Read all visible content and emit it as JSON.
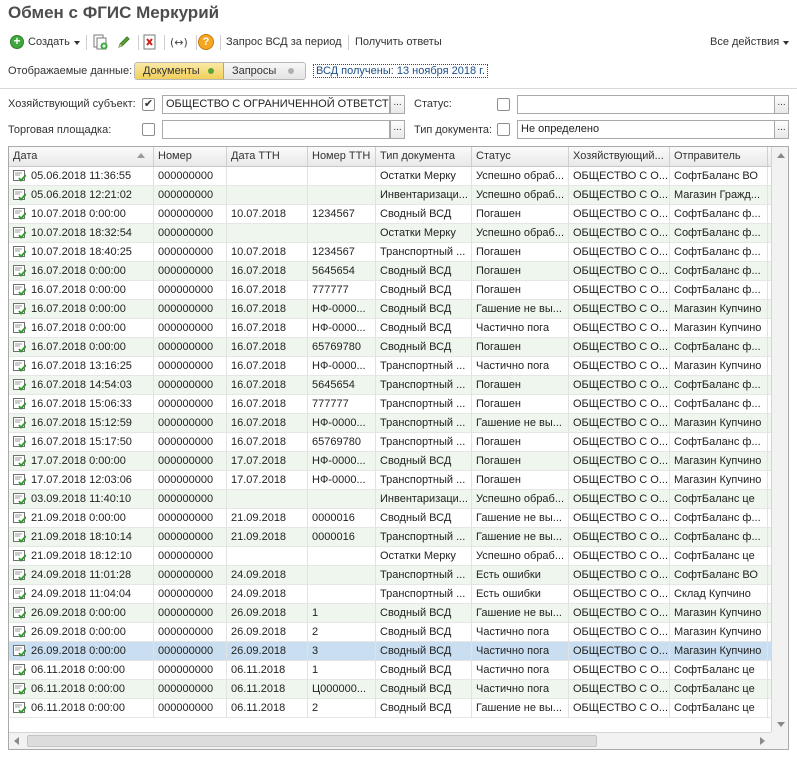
{
  "window": {
    "title": "Обмен с ФГИС Меркурий"
  },
  "toolbar": {
    "create_label": "Создать",
    "request_label": "Запрос ВСД за период",
    "get_answers_label": "Получить ответы",
    "all_actions_label": "Все действия"
  },
  "filters": {
    "displayed_label": "Отображаемые данные:",
    "tab_documents": "Документы",
    "tab_requests": "Запросы",
    "vsd_link": "ВСД получены: 13 ноября 2018 г.",
    "subject_label": "Хозяйствующий субъект:",
    "subject_checked": "✔",
    "subject_value": "ОБЩЕСТВО С ОГРАНИЧЕННОЙ ОТВЕТСТВЕННОСТЬЮ",
    "status_label": "Статус:",
    "status_value": "",
    "place_label": "Торговая площадка:",
    "place_value": "",
    "doc_type_label": "Тип документа:",
    "doc_type_value": "Не определено",
    "select_btn": "..."
  },
  "table": {
    "columns": [
      "Дата",
      "Номер",
      "Дата ТТН",
      "Номер ТТН",
      "Тип документа",
      "Статус",
      "Хозяйствующий...",
      "Отправитель",
      "П"
    ],
    "rows": [
      [
        "05.06.2018 11:36:55",
        "000000000",
        "",
        "",
        "Остатки Мерку",
        "Успешно обраб...",
        "ОБЩЕСТВО С О...",
        "СофтБаланс ВО",
        ""
      ],
      [
        "05.06.2018 12:21:02",
        "000000000",
        "",
        "",
        "Инвентаризаци...",
        "Успешно обраб...",
        "ОБЩЕСТВО С О...",
        "Магазин Гражд...",
        ""
      ],
      [
        "10.07.2018 0:00:00",
        "000000000",
        "10.07.2018",
        "1234567",
        "Сводный ВСД",
        "Погашен",
        "ОБЩЕСТВО С О...",
        "СофтБаланс ф...",
        "М"
      ],
      [
        "10.07.2018 18:32:54",
        "000000000",
        "",
        "",
        "Остатки Мерку",
        "Успешно обраб...",
        "ОБЩЕСТВО С О...",
        "СофтБаланс ф...",
        ""
      ],
      [
        "10.07.2018 18:40:25",
        "000000000",
        "10.07.2018",
        "1234567",
        "Транспортный ...",
        "Погашен",
        "ОБЩЕСТВО С О...",
        "СофтБаланс ф...",
        "М"
      ],
      [
        "16.07.2018 0:00:00",
        "000000000",
        "16.07.2018",
        "5645654",
        "Сводный ВСД",
        "Погашен",
        "ОБЩЕСТВО С О...",
        "СофтБаланс ф...",
        "М"
      ],
      [
        "16.07.2018 0:00:00",
        "000000000",
        "16.07.2018",
        "777777",
        "Сводный ВСД",
        "Погашен",
        "ОБЩЕСТВО С О...",
        "СофтБаланс ф...",
        "М"
      ],
      [
        "16.07.2018 0:00:00",
        "000000000",
        "16.07.2018",
        "НФ-0000...",
        "Сводный ВСД",
        "Гашение не вы...",
        "ОБЩЕСТВО С О...",
        "Магазин Купчино",
        "М"
      ],
      [
        "16.07.2018 0:00:00",
        "000000000",
        "16.07.2018",
        "НФ-0000...",
        "Сводный ВСД",
        "Частично пога",
        "ОБЩЕСТВО С О...",
        "Магазин Купчино",
        "С"
      ],
      [
        "16.07.2018 0:00:00",
        "000000000",
        "16.07.2018",
        "65769780",
        "Сводный ВСД",
        "Погашен",
        "ОБЩЕСТВО С О...",
        "СофтБаланс ф...",
        "М"
      ],
      [
        "16.07.2018 13:16:25",
        "000000000",
        "16.07.2018",
        "НФ-0000...",
        "Транспортный ...",
        "Частично пога",
        "ОБЩЕСТВО С О...",
        "Магазин Купчино",
        "С"
      ],
      [
        "16.07.2018 14:54:03",
        "000000000",
        "16.07.2018",
        "5645654",
        "Транспортный ...",
        "Погашен",
        "ОБЩЕСТВО С О...",
        "СофтБаланс ф...",
        "М"
      ],
      [
        "16.07.2018 15:06:33",
        "000000000",
        "16.07.2018",
        "777777",
        "Транспортный ...",
        "Погашен",
        "ОБЩЕСТВО С О...",
        "СофтБаланс ф...",
        "М"
      ],
      [
        "16.07.2018 15:12:59",
        "000000000",
        "16.07.2018",
        "НФ-0000...",
        "Транспортный ...",
        "Гашение не вы...",
        "ОБЩЕСТВО С О...",
        "Магазин Купчино",
        "М"
      ],
      [
        "16.07.2018 15:17:50",
        "000000000",
        "16.07.2018",
        "65769780",
        "Транспортный ...",
        "Погашен",
        "ОБЩЕСТВО С О...",
        "СофтБаланс ф...",
        "М"
      ],
      [
        "17.07.2018 0:00:00",
        "000000000",
        "17.07.2018",
        "НФ-0000...",
        "Сводный ВСД",
        "Погашен",
        "ОБЩЕСТВО С О...",
        "Магазин Купчино",
        "М"
      ],
      [
        "17.07.2018 12:03:06",
        "000000000",
        "17.07.2018",
        "НФ-0000...",
        "Транспортный ...",
        "Погашен",
        "ОБЩЕСТВО С О...",
        "Магазин Купчино",
        "М"
      ],
      [
        "03.09.2018 11:40:10",
        "000000000",
        "",
        "",
        "Инвентаризаци...",
        "Успешно обраб...",
        "ОБЩЕСТВО С О...",
        "СофтБаланс це",
        ""
      ],
      [
        "21.09.2018 0:00:00",
        "000000000",
        "21.09.2018",
        "0000016",
        "Сводный ВСД",
        "Гашение не вы...",
        "ОБЩЕСТВО С О...",
        "СофтБаланс ф...",
        "М"
      ],
      [
        "21.09.2018 18:10:14",
        "000000000",
        "21.09.2018",
        "0000016",
        "Транспортный ...",
        "Гашение не вы...",
        "ОБЩЕСТВО С О...",
        "СофтБаланс ф...",
        "М"
      ],
      [
        "21.09.2018 18:12:10",
        "000000000",
        "",
        "",
        "Остатки Мерку",
        "Успешно обраб...",
        "ОБЩЕСТВО С О...",
        "СофтБаланс це",
        ""
      ],
      [
        "24.09.2018 11:01:28",
        "000000000",
        "24.09.2018",
        "",
        "Транспортный ...",
        "Есть ошибки",
        "ОБЩЕСТВО С О...",
        "СофтБаланс ВО",
        "С"
      ],
      [
        "24.09.2018 11:04:04",
        "000000000",
        "24.09.2018",
        "",
        "Транспортный ...",
        "Есть ошибки",
        "ОБЩЕСТВО С О...",
        "Склад Купчино",
        "С"
      ],
      [
        "26.09.2018 0:00:00",
        "000000000",
        "26.09.2018",
        "1",
        "Сводный ВСД",
        "Гашение не вы...",
        "ОБЩЕСТВО С О...",
        "Магазин Купчино",
        "М"
      ],
      [
        "26.09.2018 0:00:00",
        "000000000",
        "26.09.2018",
        "2",
        "Сводный ВСД",
        "Частично пога",
        "ОБЩЕСТВО С О...",
        "Магазин Купчино",
        "М"
      ],
      [
        "26.09.2018 0:00:00",
        "000000000",
        "26.09.2018",
        "3",
        "Сводный ВСД",
        "Частично пога",
        "ОБЩЕСТВО С О...",
        "Магазин Купчино",
        "М"
      ],
      [
        "06.11.2018 0:00:00",
        "000000000",
        "06.11.2018",
        "1",
        "Сводный ВСД",
        "Частично пога",
        "ОБЩЕСТВО С О...",
        "СофтБаланс це",
        ""
      ],
      [
        "06.11.2018 0:00:00",
        "000000000",
        "06.11.2018",
        "Ц000000...",
        "Сводный ВСД",
        "Частично пога",
        "ОБЩЕСТВО С О...",
        "СофтБаланс це",
        ""
      ],
      [
        "06.11.2018 0:00:00",
        "000000000",
        "06.11.2018",
        "2",
        "Сводный ВСД",
        "Гашение не вы...",
        "ОБЩЕСТВО С О...",
        "СофтБаланс це",
        "С"
      ]
    ],
    "selected_row": 25
  },
  "colors": {
    "accent": "#f1cf5a",
    "row_alt": "#eef6ee",
    "row_selected": "#c9def0",
    "link": "#1a4f8b"
  },
  "icons": {
    "create": "plus-circle-icon",
    "copy": "copy-document-icon",
    "edit": "pencil-icon",
    "delete": "delete-x-icon",
    "swap": "swap-arrows-icon",
    "help": "question-icon",
    "row": "vsd-document-icon"
  }
}
